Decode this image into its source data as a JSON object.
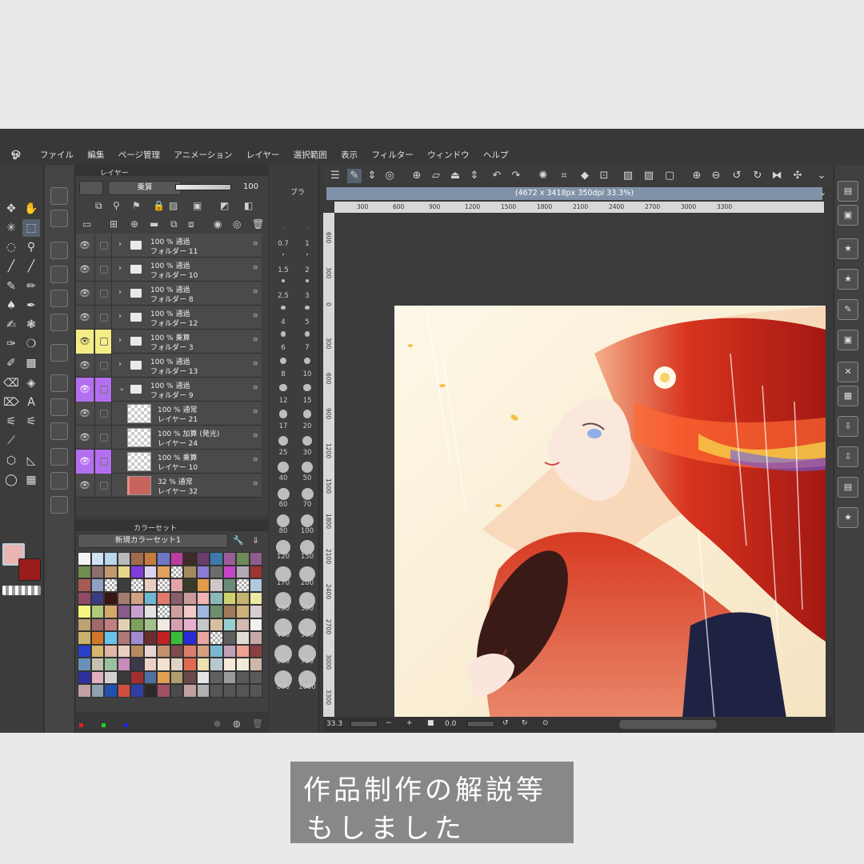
{
  "menu": [
    "ファイル",
    "編集",
    "ページ管理",
    "アニメーション",
    "レイヤー",
    "選択範囲",
    "表示",
    "フィルター",
    "ウィンドウ",
    "ヘルプ"
  ],
  "layer_panel": {
    "tab_label": "レイヤー",
    "blend_mode": "乗算",
    "opacity": "100",
    "layers": [
      {
        "opacity_mode": "100 % 通過",
        "name": "フォルダー 11",
        "kind": "folder",
        "highlight": "none"
      },
      {
        "opacity_mode": "100 % 通過",
        "name": "フォルダー 10",
        "kind": "folder",
        "highlight": "none"
      },
      {
        "opacity_mode": "100 % 通過",
        "name": "フォルダー 8",
        "kind": "folder",
        "highlight": "none"
      },
      {
        "opacity_mode": "100 % 通過",
        "name": "フォルダー 12",
        "kind": "folder",
        "highlight": "none"
      },
      {
        "opacity_mode": "100 % 乗算",
        "name": "フォルダー 3",
        "kind": "folder",
        "highlight": "yellow"
      },
      {
        "opacity_mode": "100 % 通過",
        "name": "フォルダー 13",
        "kind": "folder",
        "highlight": "none"
      },
      {
        "opacity_mode": "100 % 通過",
        "name": "フォルダー 9",
        "kind": "folder-open",
        "highlight": "purple"
      },
      {
        "opacity_mode": "100 % 通常",
        "name": "レイヤー 21",
        "kind": "layer",
        "highlight": "none"
      },
      {
        "opacity_mode": "100 % 加算 (発光)",
        "name": "レイヤー 24",
        "kind": "layer",
        "highlight": "none"
      },
      {
        "opacity_mode": "100 % 乗算",
        "name": "レイヤー 10",
        "kind": "layer",
        "highlight": "purple"
      },
      {
        "opacity_mode": "32 % 通常",
        "name": "レイヤー 32",
        "kind": "layer-color",
        "highlight": "none"
      }
    ]
  },
  "color_panel": {
    "tab_label": "カラーセット",
    "set_name": "新規カラーセット1"
  },
  "brush_panel": {
    "tab_label": "ブラ",
    "sizes": [
      "0.7",
      "1",
      "1.5",
      "2",
      "2.5",
      "3",
      "4",
      "5",
      "6",
      "7",
      "8",
      "10",
      "12",
      "15",
      "17",
      "20",
      "25",
      "30",
      "40",
      "50",
      "60",
      "70",
      "80",
      "100",
      "120",
      "150",
      "170",
      "200",
      "250",
      "300",
      "400",
      "500",
      "600",
      "700",
      "800",
      "1000"
    ]
  },
  "canvas": {
    "title": "(4672 x 3418px 350dpi 33.3%)",
    "h_ruler": [
      "300",
      "600",
      "900",
      "1200",
      "1500",
      "1800",
      "2100",
      "2400",
      "2700",
      "3000",
      "3300"
    ],
    "v_ruler": [
      "600",
      "300",
      "0",
      "300",
      "600",
      "900",
      "1200",
      "1500",
      "1800",
      "2100",
      "2400",
      "2700",
      "3000",
      "3300"
    ],
    "zoom": "33.3",
    "rotation": "0.0"
  },
  "colors": {
    "main": "#e8b5b3",
    "sub": "#9b1c1c",
    "accent_title": "#8092a8"
  },
  "caption": {
    "line1": "作品制作の解説等",
    "line2": "もしました"
  }
}
